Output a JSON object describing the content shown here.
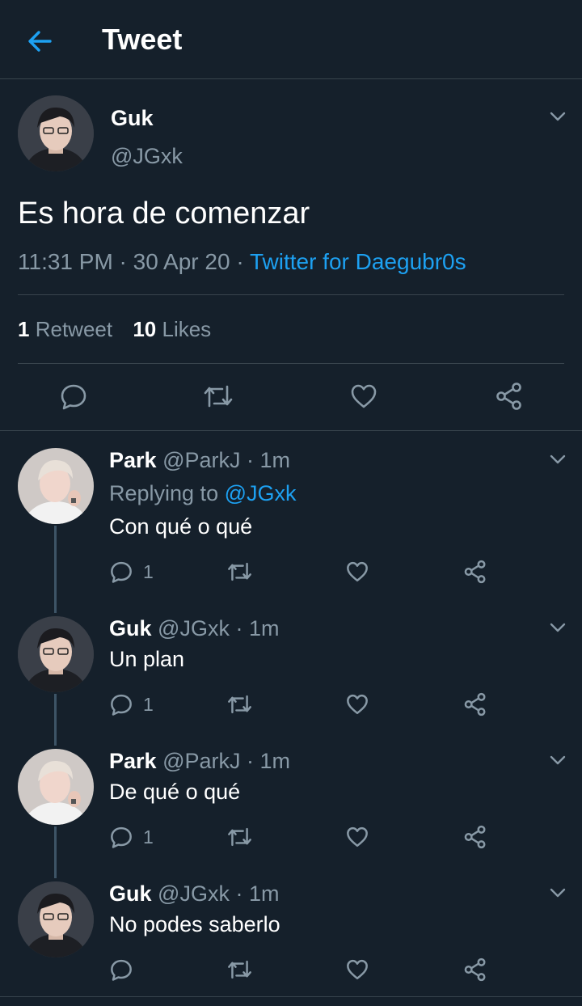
{
  "header": {
    "title": "Tweet"
  },
  "main_tweet": {
    "name": "Guk",
    "handle": "@JGxk",
    "text": "Es hora de comenzar",
    "time": "11:31 PM",
    "date": "30 Apr 20",
    "source": "Twitter for Daegubr0s",
    "retweets": {
      "count": "1",
      "label": "Retweet"
    },
    "likes": {
      "count": "10",
      "label": "Likes"
    }
  },
  "replies": [
    {
      "name": "Park",
      "handle": "@ParkJ",
      "time": "1m",
      "replying_prefix": "Replying to",
      "replying_to": "@JGxk",
      "text": "Con qué o qué",
      "reply_count": "1"
    },
    {
      "name": "Guk",
      "handle": "@JGxk",
      "time": "1m",
      "text": "Un plan",
      "reply_count": "1"
    },
    {
      "name": "Park",
      "handle": "@ParkJ",
      "time": "1m",
      "text": "De qué o qué",
      "reply_count": "1"
    },
    {
      "name": "Guk",
      "handle": "@JGxk",
      "time": "1m",
      "text": "No podes saberlo",
      "reply_count": ""
    }
  ],
  "colors": {
    "background": "#15202b",
    "accent": "#1da1f2",
    "muted": "#8899a6",
    "divider": "#38444d"
  }
}
